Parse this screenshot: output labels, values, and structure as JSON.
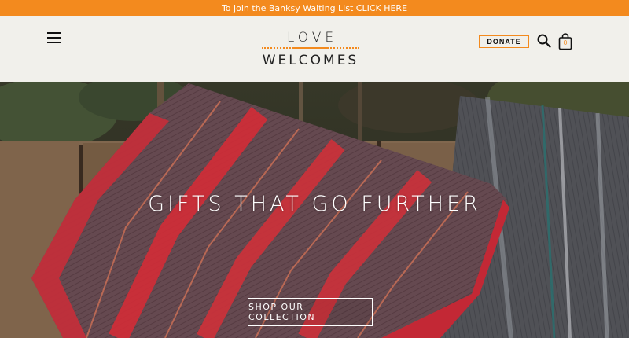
{
  "announcement": {
    "text": "To join the Banksy Waiting List CLICK HERE"
  },
  "header": {
    "logo_top": "LOVE",
    "logo_bottom": "WELCOMES",
    "donate_label": "DONATE",
    "cart_count": "0"
  },
  "hero": {
    "title": "GIFTS THAT GO FURTHER",
    "cta_label": "SHOP OUR COLLECTION"
  },
  "colors": {
    "accent": "#f38a1e",
    "header_bg": "#f1f0eb"
  },
  "icons": [
    "hamburger-menu-icon",
    "search-icon",
    "shopping-bag-icon"
  ]
}
